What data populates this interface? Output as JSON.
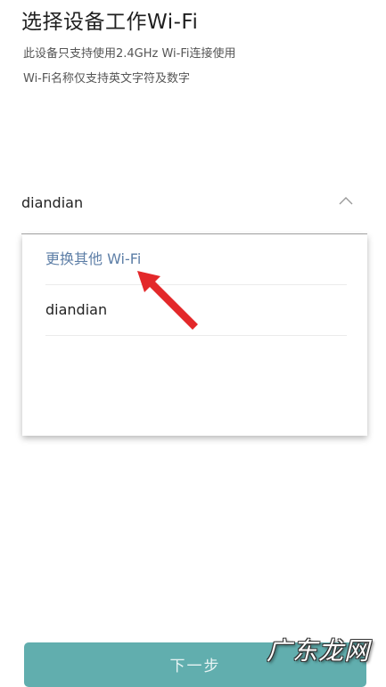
{
  "header": {
    "title": "选择设备工作Wi-Fi",
    "desc_line1": "此设备只支持使用2.4GHz Wi-Fi连接使用",
    "desc_line2": "Wi-Fi名称仅支持英文字符及数字"
  },
  "wifi_select": {
    "selected": "diandian",
    "icon": "chevron-up-icon"
  },
  "dropdown": {
    "items": [
      {
        "label": "更换其他 Wi-Fi"
      },
      {
        "label": "diandian"
      }
    ]
  },
  "annotation": {
    "icon": "red-arrow-icon",
    "color": "#e3282a"
  },
  "footer": {
    "next_label": "下一步",
    "button_color": "#61aeae"
  },
  "watermark": {
    "text": "广东龙网"
  }
}
